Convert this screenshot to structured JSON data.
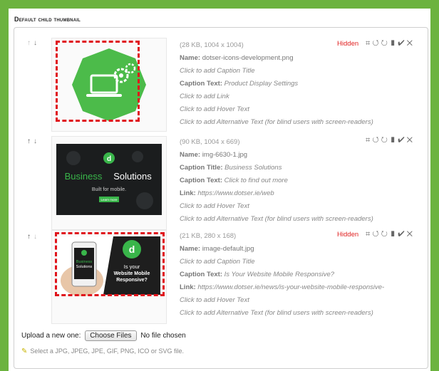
{
  "section_title": "Default child thumbnail",
  "images": [
    {
      "size": "(28 KB, 1004 x 1004)",
      "hidden_label": "Hidden",
      "name_label": "Name:",
      "name": "dotser-icons-development.png",
      "caption_title": "Click to add Caption Title",
      "caption_text_label": "Caption Text:",
      "caption_text": "Product Display Settings",
      "link": "Click to add Link",
      "hover": "Click to add Hover Text",
      "alt": "Click to add Alternative Text (for blind users with screen-readers)"
    },
    {
      "size": "(90 KB, 1004 x 669)",
      "name_label": "Name:",
      "name": "img-6630-1.jpg",
      "caption_title_label": "Caption Title:",
      "caption_title": "Business Solutions",
      "caption_text_label": "Caption Text:",
      "caption_text": "Click to find out more",
      "link_label": "Link:",
      "link": "https://www.dotser.ie/web",
      "hover": "Click to add Hover Text",
      "alt": "Click to add Alternative Text (for blind users with screen-readers)",
      "thumb_title_a": "Business",
      "thumb_title_b": "Solutions",
      "thumb_sub": "Built for mobile.",
      "thumb_btn": "Learn more",
      "thumb_logo": "d"
    },
    {
      "size": "(21 KB, 280 x 168)",
      "hidden_label": "Hidden",
      "name_label": "Name:",
      "name": "image-default.jpg",
      "caption_title": "Click to add Caption Title",
      "caption_text_label": "Caption Text:",
      "caption_text": "Is Your Website Mobile Responsive?",
      "link_label": "Link:",
      "link": "https://www.dotser.ie/news/is-your-website-mobile-responsive-",
      "hover": "Click to add Hover Text",
      "alt": "Click to add Alternative Text (for blind users with screen-readers)",
      "thumb_logo": "d",
      "thumb_q1": "Is your",
      "thumb_q2": "Website Mobile",
      "thumb_q3": "Responsive?",
      "phone_l1": "Business",
      "phone_l2": "Solutions"
    }
  ],
  "upload": {
    "label": "Upload a new one:",
    "button": "Choose Files",
    "status": "No file chosen",
    "hint": "Select a JPG, JPEG, JPE, GIF, PNG, ICO or SVG file."
  },
  "colors": {
    "brand_green": "#6cb33f",
    "hidden_red": "#e02020",
    "dash_red": "#e0141c"
  },
  "tool_icons": [
    "crop-icon",
    "rotate-left-icon",
    "rotate-right-icon",
    "copy-icon",
    "check-icon",
    "close-icon"
  ]
}
